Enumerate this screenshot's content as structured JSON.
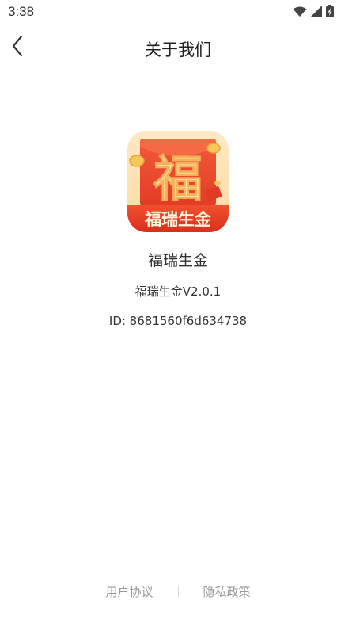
{
  "status_bar": {
    "time": "3:38",
    "icons": [
      "wifi-icon",
      "signal-icon",
      "battery-charging-icon"
    ]
  },
  "header": {
    "title": "关于我们",
    "back_icon": "chevron-left-icon"
  },
  "app": {
    "logo_char": "福",
    "logo_banner": "福瑞生金",
    "name": "福瑞生金",
    "version": "福瑞生金V2.0.1",
    "id": "ID: 8681560f6d634738"
  },
  "footer": {
    "user_agreement": "用户协议",
    "privacy_policy": "隐私政策"
  },
  "colors": {
    "logo_red": "#e8402a",
    "logo_orange": "#f07a2c",
    "logo_gold": "#f6c75a",
    "banner_red": "#e23a24",
    "footer_text": "#999999"
  }
}
